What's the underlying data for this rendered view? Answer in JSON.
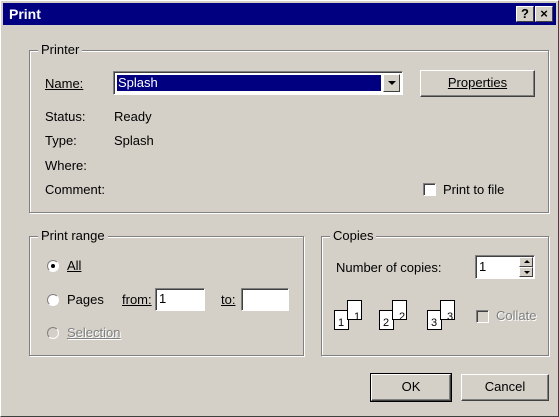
{
  "window": {
    "title": "Print",
    "help_label": "?",
    "close_label": "×"
  },
  "printer": {
    "group_label": "Printer",
    "name_label": "Name:",
    "name_value": "Splash",
    "properties_label": "Properties",
    "status_label": "Status:",
    "status_value": "Ready",
    "type_label": "Type:",
    "type_value": "Splash",
    "where_label": "Where:",
    "where_value": "",
    "comment_label": "Comment:",
    "comment_value": "",
    "print_to_file_label": "Print to file",
    "print_to_file_checked": false
  },
  "print_range": {
    "group_label": "Print range",
    "all_label": "All",
    "pages_label": "Pages",
    "from_label": "from:",
    "from_value": "1",
    "to_label": "to:",
    "to_value": "",
    "selection_label": "Selection",
    "selected_option": "All"
  },
  "copies": {
    "group_label": "Copies",
    "number_label": "Number of copies:",
    "number_value": "1",
    "collate_label": "Collate",
    "collate_checked": false,
    "collate_pages": [
      "1",
      "2",
      "3"
    ]
  },
  "buttons": {
    "ok_label": "OK",
    "cancel_label": "Cancel"
  },
  "colors": {
    "titlebar": "#000080",
    "face": "#d4d0c8",
    "selection": "#000080"
  },
  "icons": [
    "help-icon",
    "close-icon",
    "dropdown-arrow-icon",
    "spin-up-icon",
    "spin-down-icon",
    "collate-pages-icon"
  ]
}
